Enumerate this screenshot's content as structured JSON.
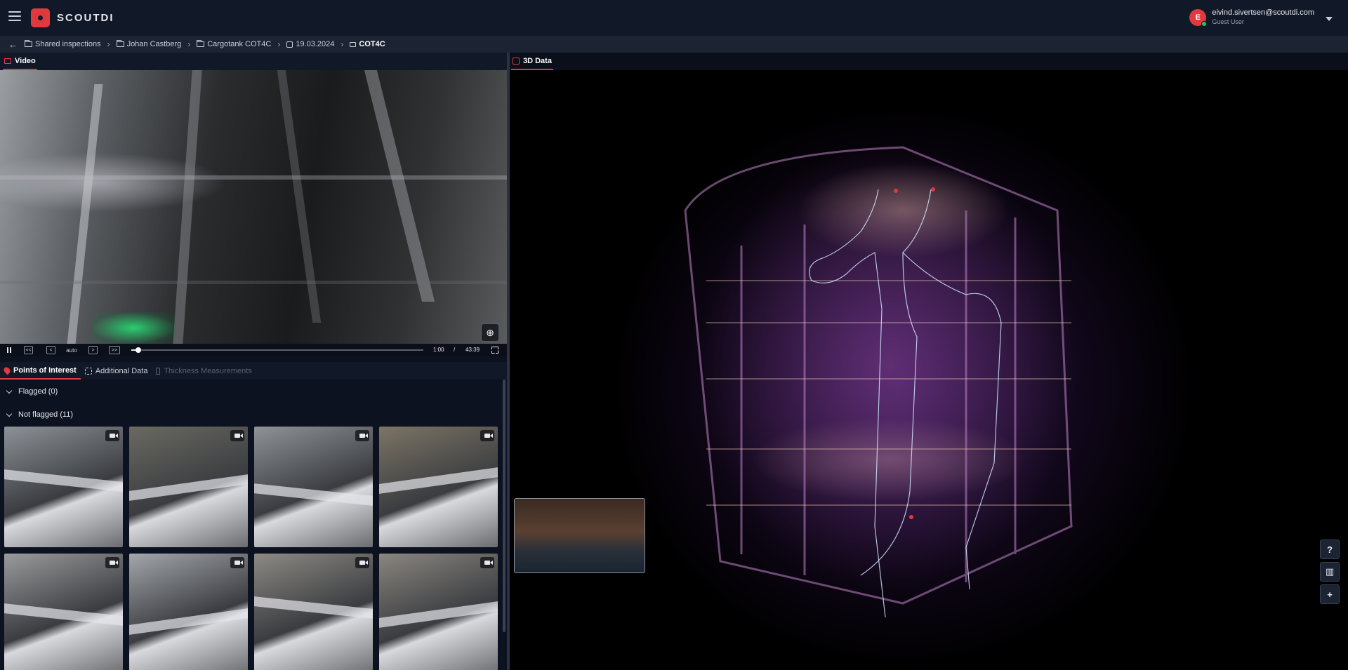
{
  "app": {
    "brand": "SCOUTDI"
  },
  "user": {
    "initial": "E",
    "email": "eivind.sivertsen@scoutdi.com",
    "role": "Guest User"
  },
  "breadcrumb": [
    {
      "label": "Shared inspections",
      "icon": "folder-icon"
    },
    {
      "label": "Johan Castberg",
      "icon": "folder-icon"
    },
    {
      "label": "Cargotank COT4C",
      "icon": "folder-icon"
    },
    {
      "label": "19.03.2024",
      "icon": "calendar-icon"
    },
    {
      "label": "COT4C",
      "icon": "video-icon"
    }
  ],
  "video_panel": {
    "tab_label": "Video"
  },
  "player": {
    "speed_label": "auto",
    "current_time": "1:00",
    "time_separator": "/",
    "duration": "43:39",
    "progress": 0.023,
    "buttons": {
      "rewind": "<<",
      "step_back": "<",
      "step_forward": ">",
      "forward": ">>"
    }
  },
  "lower_tabs": [
    {
      "label": "Points of Interest",
      "icon": "pin-icon",
      "state": "active"
    },
    {
      "label": "Additional Data",
      "icon": "scan-icon",
      "state": "normal"
    },
    {
      "label": "Thickness Measurements",
      "icon": "gauge-icon",
      "state": "disabled"
    }
  ],
  "sections": {
    "flagged": "Flagged (0)",
    "not_flagged": "Not flagged (11)"
  },
  "poi_thumbnails": [
    {
      "icon": "video-icon",
      "tone": "#8d9298"
    },
    {
      "icon": "video-icon",
      "tone": "#6a6a62"
    },
    {
      "icon": "video-icon",
      "tone": "#8f9398"
    },
    {
      "icon": "video-icon",
      "tone": "#7c7566"
    },
    {
      "icon": "video-icon",
      "tone": "#9a9b9c"
    },
    {
      "icon": "video-icon",
      "tone": "#a3a6aa"
    },
    {
      "icon": "video-icon",
      "tone": "#8d8a84"
    },
    {
      "icon": "video-icon",
      "tone": "#8a8680"
    }
  ],
  "data3d_panel": {
    "tab_label": "3D Data"
  },
  "side_tools": [
    {
      "icon": "help-icon",
      "glyph": "?"
    },
    {
      "icon": "map-icon",
      "glyph": "▥"
    },
    {
      "icon": "add-view-icon",
      "glyph": "+"
    }
  ],
  "colors": {
    "accent": "#e03a3e",
    "topbar": "#111827",
    "breadcrumb_bg": "#1c2333"
  }
}
